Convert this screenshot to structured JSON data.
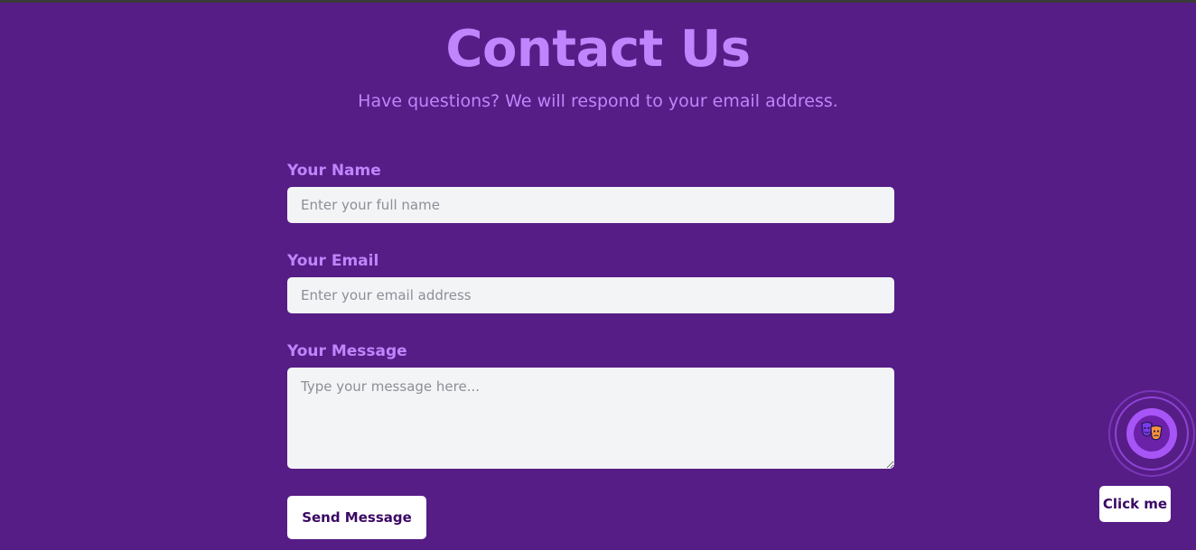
{
  "header": {
    "title": "Contact Us",
    "subtitle": "Have questions? We will respond to your email address."
  },
  "form": {
    "name": {
      "label": "Your Name",
      "placeholder": "Enter your full name",
      "value": ""
    },
    "email": {
      "label": "Your Email",
      "placeholder": "Enter your email address",
      "value": ""
    },
    "message": {
      "label": "Your Message",
      "placeholder": "Type your message here...",
      "value": ""
    },
    "submit_label": "Send Message"
  },
  "chat_widget": {
    "icon": "theater-masks-icon",
    "button_label": "Click me"
  },
  "colors": {
    "background": "#561d86",
    "accent": "#c084fc",
    "input_background": "#f3f4f6",
    "button_text": "#3b0764"
  }
}
